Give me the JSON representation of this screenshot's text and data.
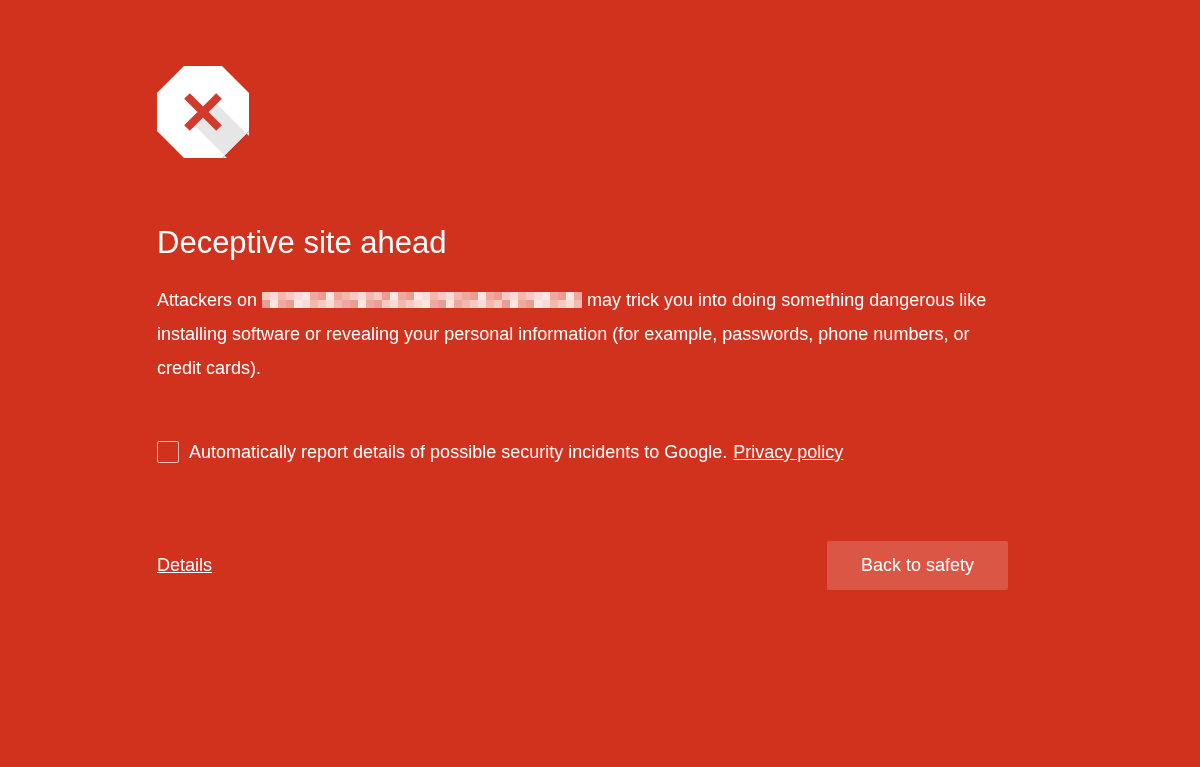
{
  "heading": "Deceptive site ahead",
  "message": {
    "text_before": "Attackers on",
    "text_after": "may trick you into doing something dangerous like installing software or revealing your personal information (for example, passwords, phone numbers, or credit cards)."
  },
  "report": {
    "label": "Automatically report details of possible security incidents to Google.",
    "link": "Privacy policy",
    "checked": false
  },
  "details_link": "Details",
  "button": "Back to safety"
}
